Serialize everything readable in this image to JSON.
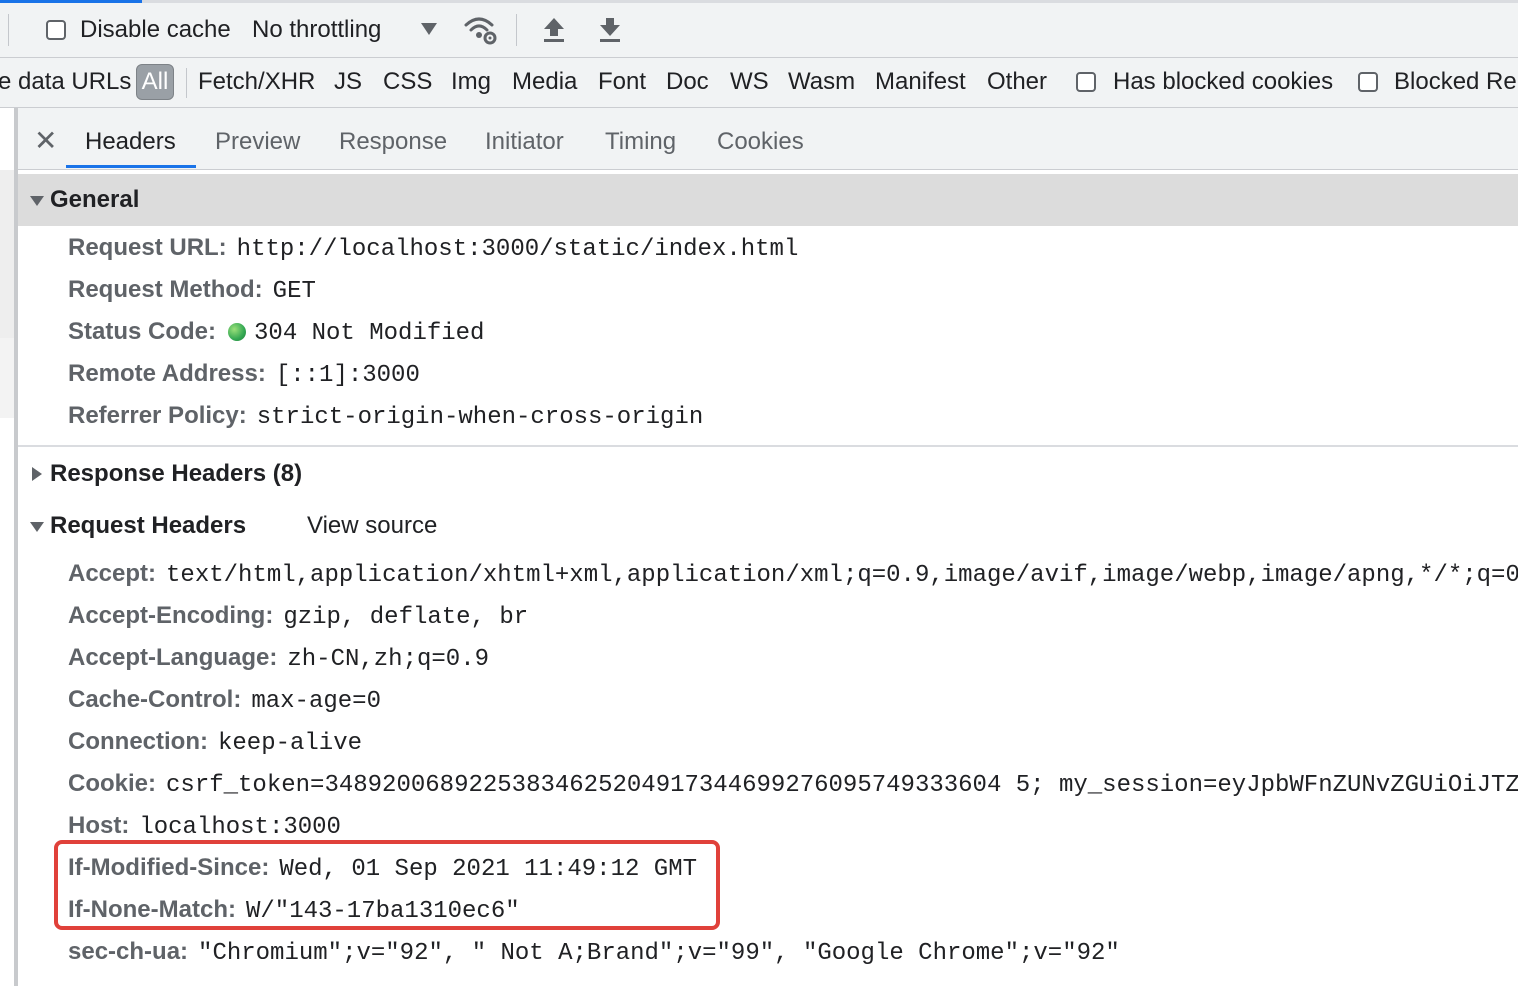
{
  "toolbar": {
    "disable_cache_label": "Disable cache",
    "throttling_value": "No throttling"
  },
  "filter": {
    "partial_label": "e data URLs",
    "types": [
      "All",
      "Fetch/XHR",
      "JS",
      "CSS",
      "Img",
      "Media",
      "Font",
      "Doc",
      "WS",
      "Wasm",
      "Manifest",
      "Other"
    ],
    "active_type": "All",
    "has_blocked_cookies_label": "Has blocked cookies",
    "blocked_requests_label": "Blocked Re"
  },
  "tabs": {
    "items": [
      "Headers",
      "Preview",
      "Response",
      "Initiator",
      "Timing",
      "Cookies"
    ],
    "active": "Headers"
  },
  "general": {
    "title": "General",
    "rows": [
      {
        "key": "Request URL:",
        "value": "http://localhost:3000/static/index.html"
      },
      {
        "key": "Request Method:",
        "value": "GET"
      },
      {
        "key": "Status Code:",
        "value": "304 Not Modified"
      },
      {
        "key": "Remote Address:",
        "value": "[::1]:3000"
      },
      {
        "key": "Referrer Policy:",
        "value": "strict-origin-when-cross-origin"
      }
    ]
  },
  "response_headers": {
    "title": "Response Headers (8)"
  },
  "request_headers": {
    "title": "Request Headers",
    "view_source_label": "View source",
    "rows": [
      {
        "key": "Accept:",
        "value": "text/html,application/xhtml+xml,application/xml;q=0.9,image/avif,image/webp,image/apng,*/*;q=0"
      },
      {
        "key": "Accept-Encoding:",
        "value": "gzip, deflate, br"
      },
      {
        "key": "Accept-Language:",
        "value": "zh-CN,zh;q=0.9"
      },
      {
        "key": "Cache-Control:",
        "value": "max-age=0"
      },
      {
        "key": "Connection:",
        "value": "keep-alive"
      },
      {
        "key": "Cookie:",
        "value": "csrf_token=34892006892253834625204917344699276095749333604 5; my_session=eyJpbWFnZUNvZGUiOiJTZD"
      },
      {
        "key": "Host:",
        "value": "localhost:3000"
      },
      {
        "key": "If-Modified-Since:",
        "value": "Wed, 01 Sep 2021 11:49:12 GMT"
      },
      {
        "key": "If-None-Match:",
        "value": "W/\"143-17ba1310ec6\""
      },
      {
        "key": "sec-ch-ua:",
        "value": "\"Chromium\";v=\"92\", \" Not A;Brand\";v=\"99\", \"Google Chrome\";v=\"92\""
      }
    ]
  },
  "colors": {
    "accent": "#1a73e8",
    "highlight": "#e0413a",
    "status_ok": "#34a853"
  }
}
